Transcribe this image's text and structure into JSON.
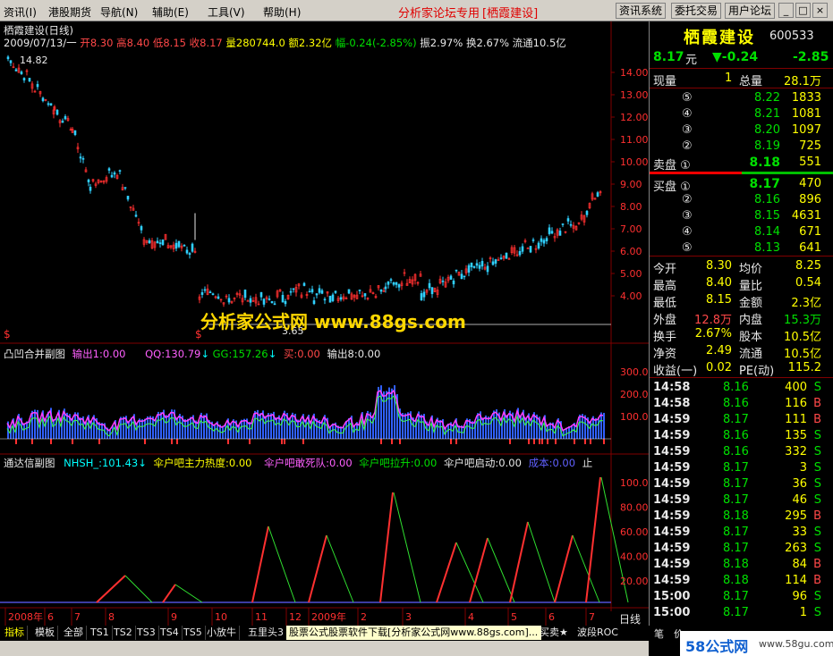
{
  "menu": {
    "items": [
      "资讯(I)",
      "港股期货",
      "导航(N)",
      "辅助(E)",
      "工具(V)",
      "帮助(H)"
    ],
    "title_prefix": "分析家论坛专用",
    "title_stock": "[栖霞建设]",
    "buttons": [
      "资讯系统",
      "委托交易",
      "用户论坛"
    ],
    "window_buttons": [
      "_",
      "□",
      "×"
    ]
  },
  "main_chart": {
    "title": "栖霞建设(日线)",
    "info_date": "2009/07/13/一",
    "info_open": "开8.30",
    "info_high": "高8.40",
    "info_low": "低8.15",
    "info_close": "收8.17",
    "info_vol": "量280744.0",
    "info_amount": "额2.32亿",
    "info_change": "幅-0.24(-2.85%)",
    "info_amp": "振2.97%",
    "info_turnover": "换2.67%",
    "info_float": "流通10.5亿",
    "peak_label": "14.82",
    "low_label": "3.65",
    "y_ticks": [
      "14.00",
      "13.00",
      "12.00",
      "11.00",
      "10.00",
      "9.00",
      "8.00",
      "7.00",
      "6.00",
      "5.00",
      "4.00"
    ],
    "watermark": "分析家公式网 www.88gs.com"
  },
  "sub1": {
    "name": "凸凹合并副图",
    "l1": "输出1:0.00",
    "l2": "QQ:130.79",
    "l3": "GG:157.26",
    "l4": "买:0.00",
    "l5": "输出8:0.00",
    "y_ticks": [
      "300.0",
      "200.0",
      "100.0"
    ]
  },
  "sub2": {
    "name": "通达信副图",
    "l1": "NHSH_:101.43",
    "l2": "伞户吧主力热度:0.00",
    "l3": "伞户吧敢死队:0.00",
    "l4": "伞户吧拉升:0.00",
    "l5": "伞户吧启动:0.00",
    "l6": "成本:0.00",
    "l7": "止",
    "y_ticks": [
      "100.0",
      "80.00",
      "60.00",
      "40.00",
      "20.00"
    ]
  },
  "xaxis": {
    "labels": [
      "2008年",
      "6",
      "7",
      "8",
      "9",
      "10",
      "11",
      "12",
      "2009年",
      "2",
      "3",
      "4",
      "5",
      "6",
      "7"
    ],
    "period": "日线"
  },
  "quote": {
    "name": "栖霞建设",
    "code": "600533",
    "price": "8.17",
    "unit": "元",
    "change": "▼-0.24",
    "pct": "-2.85",
    "xianliang_label": "现量",
    "xianliang": "1",
    "zongliang_label": "总量",
    "zongliang": "28.1万",
    "asks": [
      {
        "level": "⑤",
        "price": "8.22",
        "vol": "1833"
      },
      {
        "level": "④",
        "price": "8.21",
        "vol": "1081"
      },
      {
        "level": "③",
        "price": "8.20",
        "vol": "1097"
      },
      {
        "level": "②",
        "price": "8.19",
        "vol": "725"
      },
      {
        "level": "卖盘 ①",
        "price": "8.18",
        "vol": "551"
      }
    ],
    "bids": [
      {
        "level": "买盘 ①",
        "price": "8.17",
        "vol": "470"
      },
      {
        "level": "②",
        "price": "8.16",
        "vol": "896"
      },
      {
        "level": "③",
        "price": "8.15",
        "vol": "4631"
      },
      {
        "level": "④",
        "price": "8.14",
        "vol": "671"
      },
      {
        "level": "⑤",
        "price": "8.13",
        "vol": "641"
      }
    ],
    "stats": [
      [
        "今开",
        "8.30",
        "均价",
        "8.25"
      ],
      [
        "最高",
        "8.40",
        "量比",
        "0.54"
      ],
      [
        "最低",
        "8.15",
        "金额",
        "2.3亿"
      ],
      [
        "外盘",
        "12.8万",
        "内盘",
        "15.3万"
      ],
      [
        "换手",
        "2.67%",
        "股本",
        "10.5亿"
      ],
      [
        "净资",
        "2.49",
        "流通",
        "10.5亿"
      ],
      [
        "收益(一)",
        "0.02",
        "PE(动)",
        "115.2"
      ]
    ],
    "ticks": [
      [
        "14:58",
        "8.16",
        "400",
        "S"
      ],
      [
        "14:58",
        "8.16",
        "116",
        "B"
      ],
      [
        "14:59",
        "8.17",
        "111",
        "B"
      ],
      [
        "14:59",
        "8.16",
        "135",
        "S"
      ],
      [
        "14:59",
        "8.16",
        "332",
        "S"
      ],
      [
        "14:59",
        "8.17",
        "3",
        "S"
      ],
      [
        "14:59",
        "8.17",
        "36",
        "S"
      ],
      [
        "14:59",
        "8.17",
        "46",
        "S"
      ],
      [
        "14:59",
        "8.18",
        "295",
        "B"
      ],
      [
        "14:59",
        "8.17",
        "33",
        "S"
      ],
      [
        "14:59",
        "8.17",
        "263",
        "S"
      ],
      [
        "14:59",
        "8.18",
        "84",
        "B"
      ],
      [
        "14:59",
        "8.18",
        "114",
        "B"
      ],
      [
        "15:00",
        "8.17",
        "96",
        "S"
      ],
      [
        "15:00",
        "8.17",
        "1",
        "S"
      ]
    ]
  },
  "bottom": {
    "tabs": [
      "指标",
      "模板",
      "全部",
      "TS1",
      "TS2",
      "TS3",
      "TS4",
      "TS5",
      "小放牛",
      "五里头3"
    ],
    "ad": "股票公式股票软件下载[分析家公式网www.88gs.com]",
    "tabs_right": [
      "买卖★",
      "波段ROC"
    ],
    "right_tabs": [
      "笔",
      "价"
    ],
    "watermark_brand": "58公式网",
    "watermark_url": "www.58gu.com"
  },
  "colors": {
    "up": "#ff3030",
    "down": "#30d0ff",
    "grid": "#800000",
    "bg": "#000000"
  }
}
